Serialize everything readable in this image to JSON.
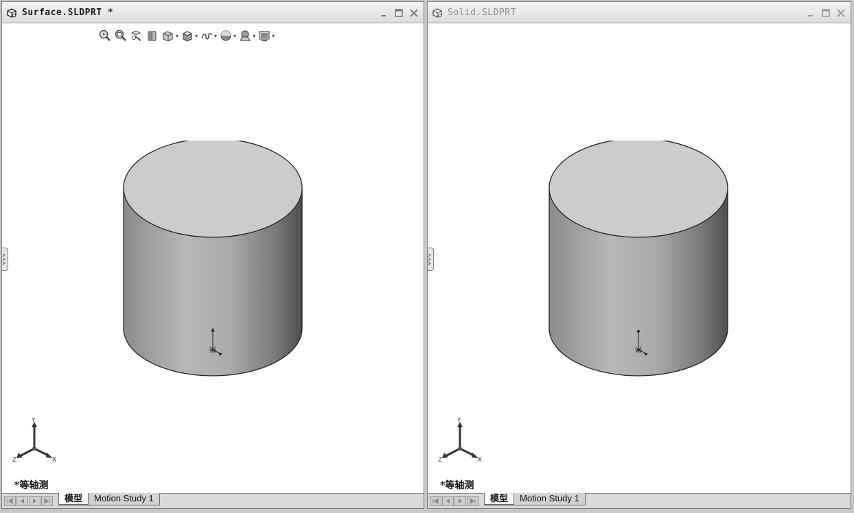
{
  "windows": [
    {
      "title": "Surface.SLDPRT *",
      "active": true,
      "view_label": "*等轴测",
      "tabs": [
        "模型",
        "Motion Study 1"
      ],
      "triad_labels": {
        "y": "Y",
        "z": "Z",
        "x": "X"
      }
    },
    {
      "title": "Solid.SLDPRT",
      "active": false,
      "view_label": "*等轴测",
      "tabs": [
        "模型",
        "Motion Study 1"
      ],
      "triad_labels": {
        "y": "Y",
        "z": "Z",
        "x": "X"
      }
    }
  ],
  "heads_up_toolbar": [
    "zoom-to-fit-icon",
    "zoom-to-area-icon",
    "previous-view-icon",
    "section-view-icon",
    "view-orientation-icon",
    "display-style-icon",
    "hide-show-items-icon",
    "edit-appearance-icon",
    "apply-scene-icon",
    "view-settings-icon"
  ],
  "window_buttons": [
    "minimize-icon",
    "maximize-icon",
    "close-icon"
  ],
  "nav_buttons": [
    "first-icon",
    "prev-icon",
    "next-icon",
    "last-icon"
  ]
}
